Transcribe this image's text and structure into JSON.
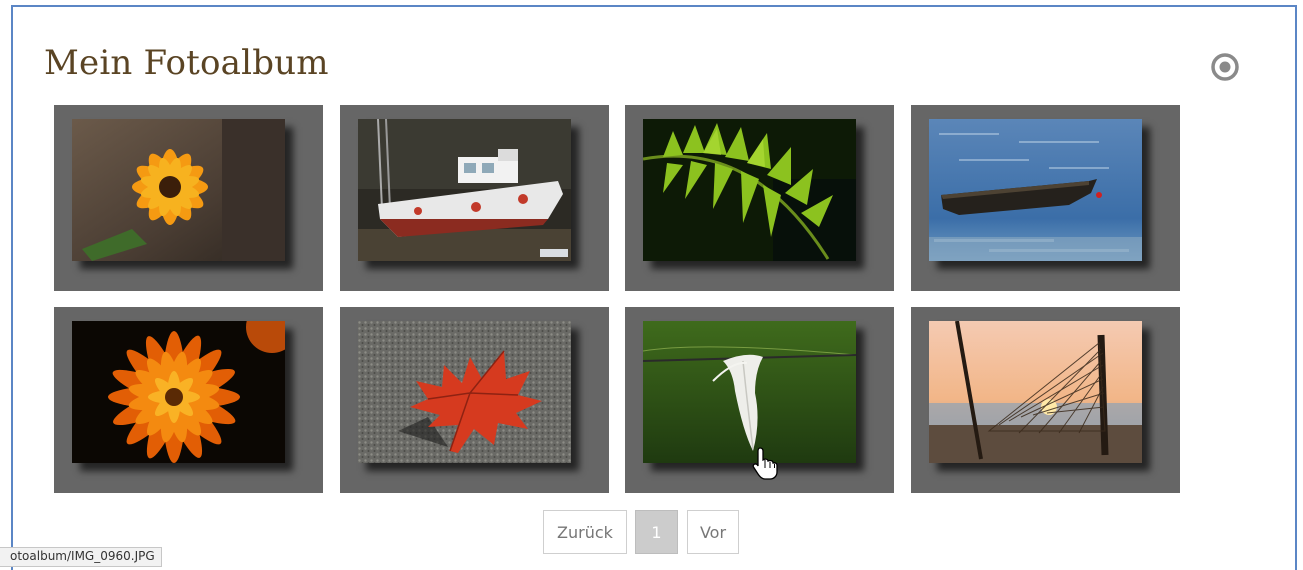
{
  "album": {
    "title": "Mein Fotoalbum",
    "settings_icon": "settings-circle-icon"
  },
  "photos": [
    {
      "alt": "Orange flower",
      "subject": "flower"
    },
    {
      "alt": "Boat on shore",
      "subject": "boat"
    },
    {
      "alt": "Fern leaf",
      "subject": "fern"
    },
    {
      "alt": "Rowboat on sea",
      "subject": "rowboat"
    },
    {
      "alt": "Orange chrysanthemum",
      "subject": "chrysanthemum"
    },
    {
      "alt": "Red maple leaf",
      "subject": "leaf"
    },
    {
      "alt": "Feather on wire",
      "subject": "feather"
    },
    {
      "alt": "Fishing net at sunset",
      "subject": "net"
    }
  ],
  "pagination": {
    "prev_label": "Zurück",
    "current_page": "1",
    "next_label": "Vor"
  },
  "status_bar": {
    "url": "otoalbum/IMG_0960.JPG"
  },
  "colors": {
    "frame_border": "#5b86c5",
    "title": "#5a4424",
    "tile_bg": "#666666"
  }
}
